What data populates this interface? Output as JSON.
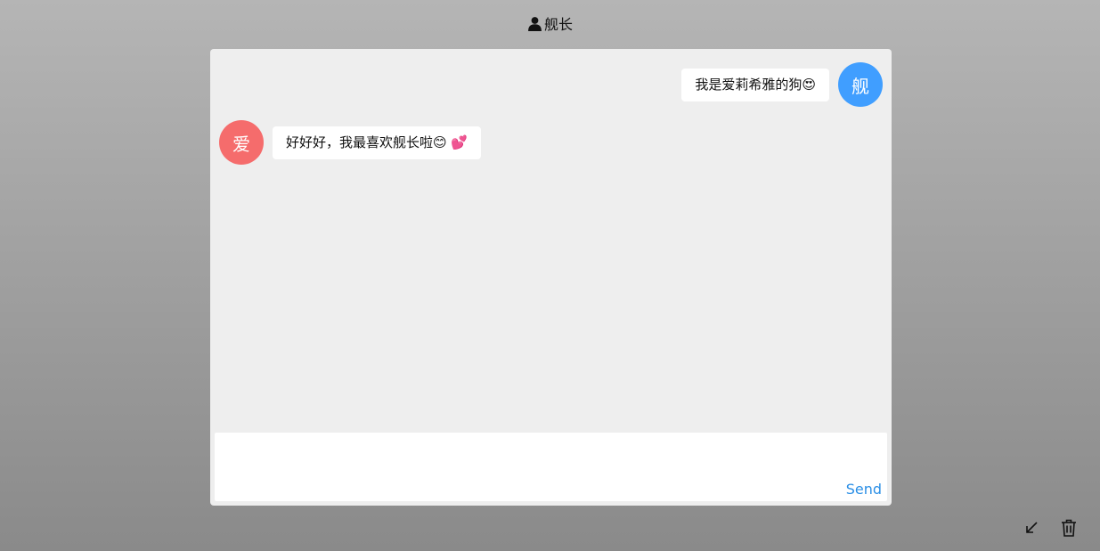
{
  "header": {
    "title": "舰长",
    "icon": "user-icon"
  },
  "colors": {
    "background_top": "#b5b5b5",
    "background_bottom": "#8a8a8a",
    "panel": "#eeeeee",
    "self_avatar": "#409eff",
    "other_avatar": "#f56c6c",
    "send": "#2b8fe6"
  },
  "messages": [
    {
      "sender": "self",
      "avatar_text": "舰",
      "text": "我是爱莉希雅的狗😍"
    },
    {
      "sender": "other",
      "avatar_text": "爱",
      "text": "好好好，我最喜欢舰长啦😊 💕"
    }
  ],
  "composer": {
    "value": "",
    "send_label": "Send"
  },
  "tools": [
    {
      "icon": "arrow-down-left-icon"
    },
    {
      "icon": "trash-icon"
    }
  ]
}
